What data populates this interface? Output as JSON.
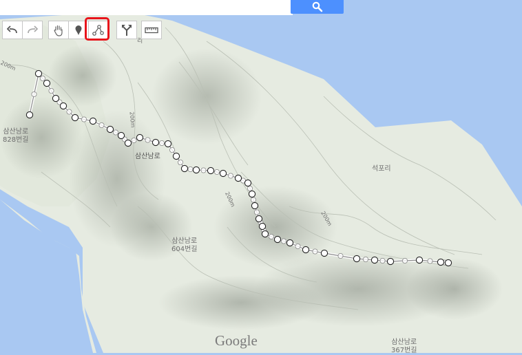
{
  "search": {
    "value": "",
    "button_icon": "search-icon"
  },
  "toolbar": {
    "buttons": [
      {
        "icon": "undo-icon"
      },
      {
        "icon": "redo-icon"
      },
      {
        "icon": "hand-pan-icon"
      },
      {
        "icon": "marker-icon"
      },
      {
        "icon": "draw-line-icon",
        "selected": true
      },
      {
        "icon": "directions-icon"
      },
      {
        "icon": "ruler-icon"
      }
    ],
    "selection_color": "#e8141b"
  },
  "map": {
    "labels": {
      "road_828_line1": "삼산남로",
      "road_828_line2": "828번길",
      "road_main": "삼산남로",
      "village": "석포리",
      "road_604_line1": "삼산남로",
      "road_604_line2": "604번길",
      "road_367_line1": "삼산남로",
      "road_367_line2": "367번길",
      "contour_a": "200m",
      "contour_b": "200m",
      "contour_c": "200m",
      "contour_d": "200m",
      "north_fragment": "리"
    },
    "attribution": "Google",
    "colors": {
      "water": "#a9c8f2",
      "land": "#e9ede4",
      "route": "#ffffff"
    }
  }
}
